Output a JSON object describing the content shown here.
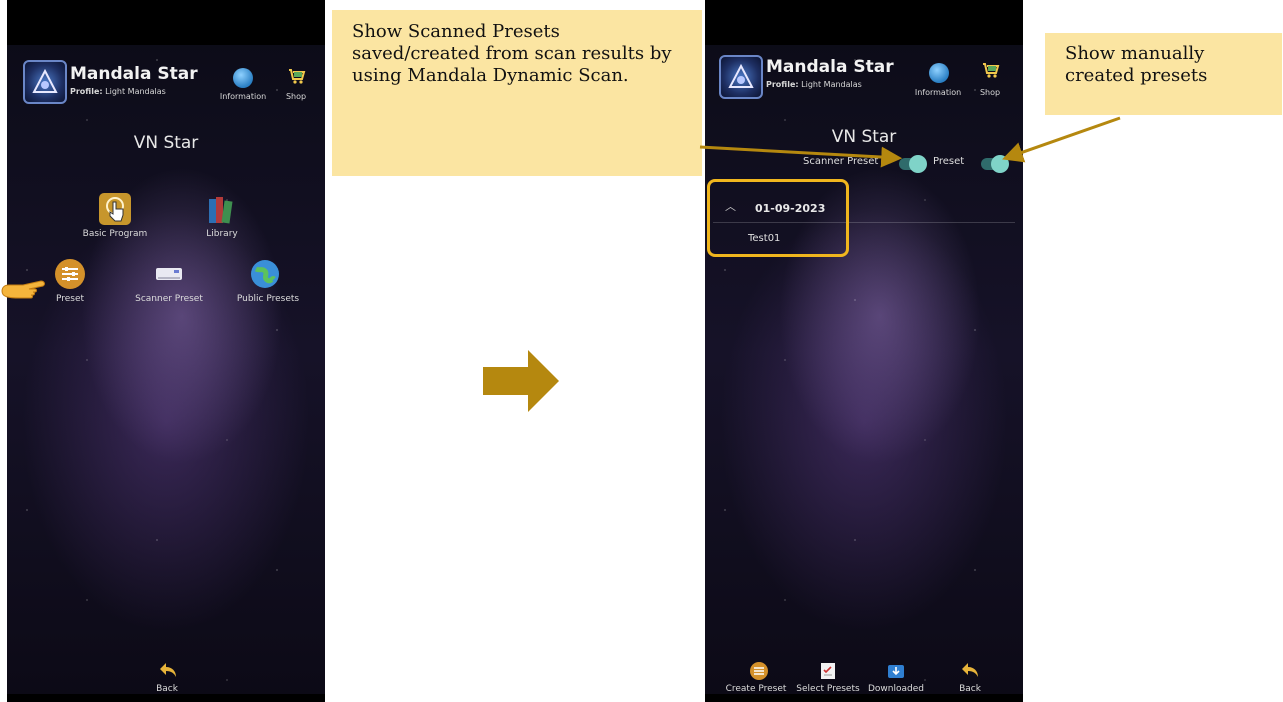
{
  "left_screen": {
    "app_title": "Mandala Star",
    "profile_label": "Profile:",
    "profile_value": "Light Mandalas",
    "info_label": "Information",
    "shop_label": "Shop",
    "star_name": "VN Star",
    "menu": [
      {
        "label": "Basic Program",
        "icon": "hand-pointer-icon"
      },
      {
        "label": "Library",
        "icon": "books-icon"
      },
      {
        "label": "Preset",
        "icon": "sliders-icon"
      },
      {
        "label": "Scanner Preset",
        "icon": "scanner-icon"
      },
      {
        "label": "Public Presets",
        "icon": "globe-icon"
      }
    ],
    "back_label": "Back"
  },
  "callout_scanned": "Show Scanned Presets saved/created from scan results by using Mandala Dynamic Scan.",
  "callout_manual": "Show manually created presets",
  "right_screen": {
    "app_title": "Mandala Star",
    "profile_label": "Profile:",
    "profile_value": "Light Mandalas",
    "info_label": "Information",
    "shop_label": "Shop",
    "star_name": "VN Star",
    "toggle_scanner_label": "Scanner Preset",
    "toggle_preset_label": "Preset",
    "date_group": "01-09-2023",
    "preset_item": "Test01",
    "bottom_nav": [
      {
        "label": "Create Preset",
        "icon": "create-preset-icon"
      },
      {
        "label": "Select Presets",
        "icon": "select-presets-icon"
      },
      {
        "label": "Downloaded",
        "icon": "downloaded-icon"
      },
      {
        "label": "Back",
        "icon": "back-arrow-icon"
      }
    ]
  },
  "colors": {
    "callout_bg": "#fbe5a2",
    "accent_gold": "#b5880f",
    "highlight_border": "#f0b61e",
    "toggle_knob": "#7fd3c8"
  }
}
